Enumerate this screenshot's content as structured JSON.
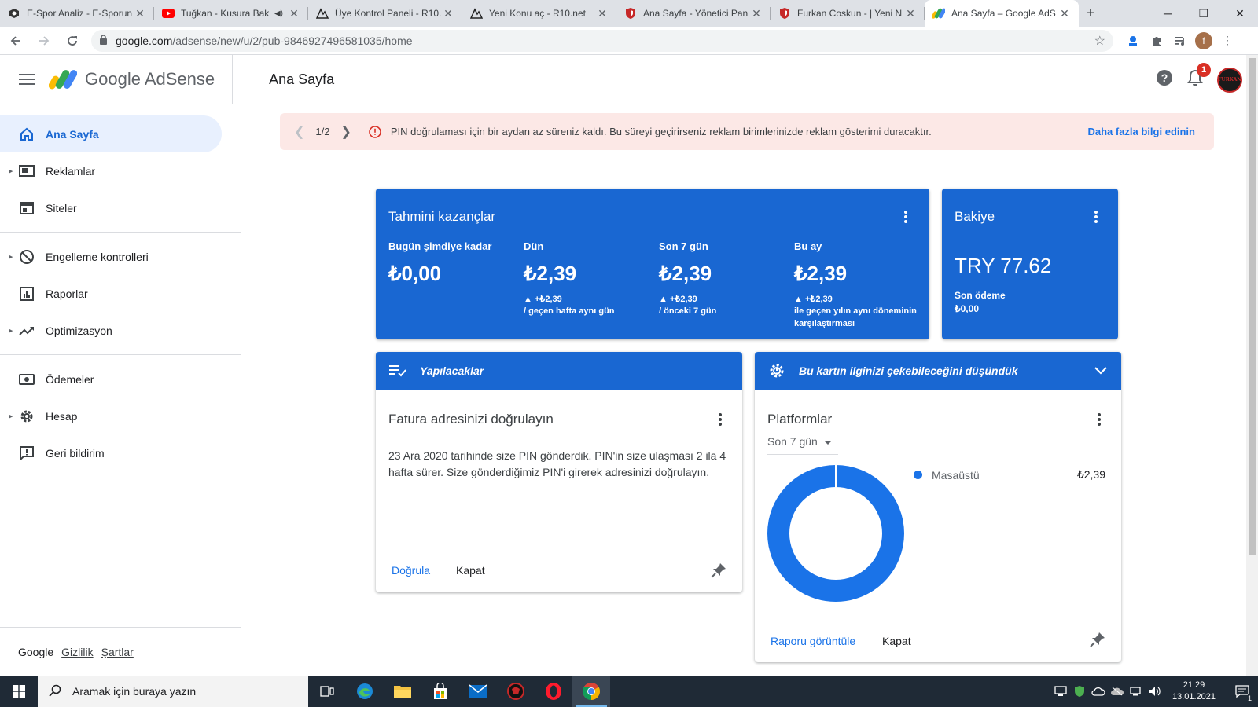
{
  "browser": {
    "tabs": [
      {
        "title": "E-Spor Analiz - E-Sporun",
        "icon": "site-favicon",
        "active": false
      },
      {
        "title": "Tuğkan - Kusura Bak",
        "icon": "youtube-icon",
        "active": false,
        "muted": true
      },
      {
        "title": "Üye Kontrol Paneli - R10.",
        "icon": "r10-icon",
        "active": false
      },
      {
        "title": "Yeni Konu aç - R10.net",
        "icon": "r10-icon",
        "active": false
      },
      {
        "title": "Ana Sayfa - Yönetici Pan",
        "icon": "shield-icon",
        "active": false
      },
      {
        "title": "Furkan Coskun - | Yeni N",
        "icon": "shield-icon",
        "active": false
      },
      {
        "title": "Ana Sayfa – Google AdS",
        "icon": "adsense-icon",
        "active": true
      }
    ],
    "url_host": "google.com",
    "url_path": "/adsense/new/u/2/pub-9846927496581035/home",
    "profile_initial": "f"
  },
  "header": {
    "brand": "Google AdSense",
    "page_title": "Ana Sayfa",
    "notification_count": "1",
    "avatar_text": "FURKAN"
  },
  "sidebar": {
    "items": [
      {
        "label": "Ana Sayfa",
        "icon": "home-icon",
        "active": true,
        "expandable": false
      },
      {
        "label": "Reklamlar",
        "icon": "ads-icon",
        "active": false,
        "expandable": true
      },
      {
        "label": "Siteler",
        "icon": "sites-icon",
        "active": false,
        "expandable": false
      },
      {
        "label": "Engelleme kontrolleri",
        "icon": "block-icon",
        "active": false,
        "expandable": true
      },
      {
        "label": "Raporlar",
        "icon": "reports-icon",
        "active": false,
        "expandable": false
      },
      {
        "label": "Optimizasyon",
        "icon": "trending-icon",
        "active": false,
        "expandable": true
      },
      {
        "label": "Ödemeler",
        "icon": "payments-icon",
        "active": false,
        "expandable": false
      },
      {
        "label": "Hesap",
        "icon": "gear-icon",
        "active": false,
        "expandable": true
      },
      {
        "label": "Geri bildirim",
        "icon": "feedback-icon",
        "active": false,
        "expandable": false
      }
    ],
    "footer": {
      "google": "Google",
      "privacy": "Gizlilik",
      "terms": "Şartlar"
    }
  },
  "banner": {
    "pager": "1/2",
    "message": "PIN doğrulaması için bir aydan az süreniz kaldı. Bu süreyi geçirirseniz reklam birimlerinizde reklam gösterimi duracaktır.",
    "link": "Daha fazla bilgi edinin"
  },
  "earnings": {
    "title": "Tahmini kazançlar",
    "metrics": [
      {
        "label": "Bugün şimdiye kadar",
        "value": "₺0,00",
        "delta": "",
        "note": ""
      },
      {
        "label": "Dün",
        "value": "₺2,39",
        "delta": "▲ +₺2,39",
        "note": "/ geçen hafta aynı gün"
      },
      {
        "label": "Son 7 gün",
        "value": "₺2,39",
        "delta": "▲ +₺2,39",
        "note": "/ önceki 7 gün"
      },
      {
        "label": "Bu ay",
        "value": "₺2,39",
        "delta": "▲ +₺2,39",
        "note": "ile geçen yılın aynı döneminin karşılaştırması"
      }
    ]
  },
  "balance": {
    "title": "Bakiye",
    "value": "TRY 77.62",
    "last_payment_label": "Son ödeme",
    "last_payment_value": "₺0,00"
  },
  "todo": {
    "header": "Yapılacaklar",
    "title": "Fatura adresinizi doğrulayın",
    "body": "23 Ara 2020 tarihinde size PIN gönderdik. PIN'in size ulaşması 2 ila 4 hafta sürer. Size gönderdiğimiz PIN'i girerek adresinizi doğrulayın.",
    "action_primary": "Doğrula",
    "action_secondary": "Kapat"
  },
  "platforms": {
    "header": "Bu kartın ilginizi çekebileceğini düşündük",
    "title": "Platformlar",
    "range": "Son 7 gün",
    "legend": [
      {
        "label": "Masaüstü",
        "value": "₺2,39",
        "share": 1.0,
        "color": "#1a73e8"
      }
    ],
    "action_primary": "Raporu görüntüle",
    "action_secondary": "Kapat"
  },
  "taskbar": {
    "search_placeholder": "Aramak için buraya yazın",
    "time": "21:29",
    "date": "13.01.2021",
    "notification_count": "1"
  },
  "colors": {
    "brand_blue": "#1967d2",
    "link_blue": "#1a73e8",
    "alert_bg": "#fce8e6",
    "alert_red": "#d93025"
  }
}
